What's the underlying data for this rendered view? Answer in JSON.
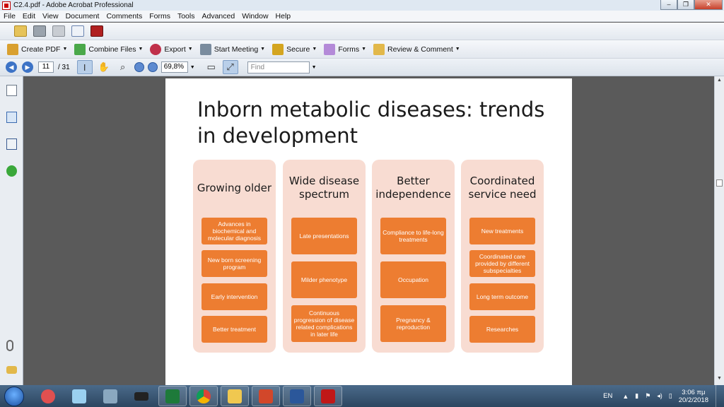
{
  "window": {
    "title": "C2.4.pdf - Adobe Acrobat Professional",
    "minimize": "–",
    "restore": "❐",
    "close": "✕"
  },
  "menu": [
    "File",
    "Edit",
    "View",
    "Document",
    "Comments",
    "Forms",
    "Tools",
    "Advanced",
    "Window",
    "Help"
  ],
  "task_toolbar": {
    "create_pdf": "Create PDF",
    "combine_files": "Combine Files",
    "export": "Export",
    "start_meeting": "Start Meeting",
    "secure": "Secure",
    "forms": "Forms",
    "review_comment": "Review & Comment"
  },
  "nav_toolbar": {
    "page_current": "11",
    "page_count": "/ 31",
    "zoom": "69,8%",
    "find_placeholder": "Find"
  },
  "slide": {
    "title": "Inborn metabolic diseases: trends in development",
    "columns": [
      {
        "heading": "Growing older",
        "items": [
          "Advances in biochemical and molecular diagnosis",
          "New born screening program",
          "Early intervention",
          "Better treatment"
        ]
      },
      {
        "heading": "Wide disease spectrum",
        "items": [
          "Late presentations",
          "Milder phenotype",
          "Continuous progression of disease related complications in later life"
        ]
      },
      {
        "heading": "Better independence",
        "items": [
          "Compliance to life-long treatments",
          "Occupation",
          "Pregnancy & reproduction"
        ]
      },
      {
        "heading": "Coordinated service need",
        "items": [
          "New treatments",
          "Coordinated care provided by different subspecialties",
          "Long term outcome",
          "Researches"
        ]
      }
    ]
  },
  "taskbar": {
    "language": "EN",
    "time": "3:06 πμ",
    "date": "20/2/2018"
  },
  "colors": {
    "column_bg": "#f8dcd2",
    "cell_bg": "#ed7d31",
    "doc_bg": "#5a5a5a"
  }
}
